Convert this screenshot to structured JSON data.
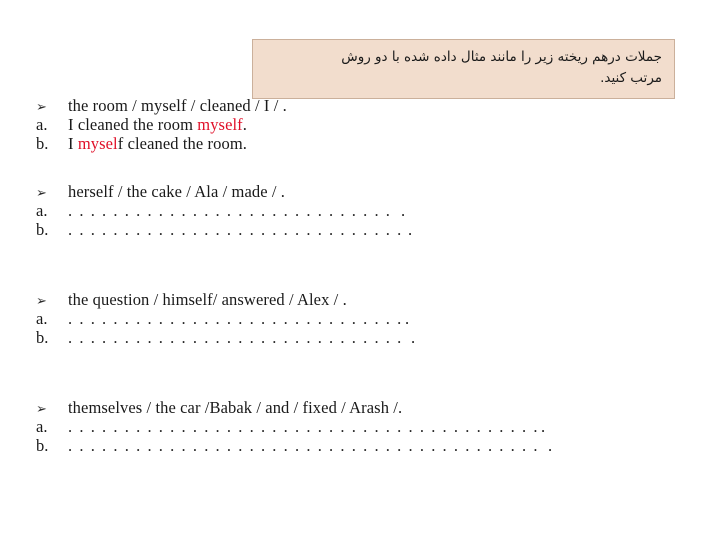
{
  "instruction": {
    "line1": "جملات درهم ریخته زیر را مانند مثال داده شده با دو روش",
    "line2": "مرتب کنید."
  },
  "markers": {
    "bullet": "➢",
    "a": "a.",
    "b": "b."
  },
  "colors": {
    "callout_bg": "#f2ddcd",
    "callout_border": "#cbb09b",
    "highlight_red": "#e01029",
    "text": "#1a1a1a",
    "page_bg": "#ffffff"
  },
  "dot_leader": ". . . . . . . . . . . . . . . . . . . . . . . . . . . . . . . . . . . . . . . . . . . . . . . . . . . . . . . . . . . . . . . . . . . . . . . . . . . . . . . . . . . . . . . . . .",
  "dot_tail": ".",
  "exercises": [
    {
      "prompt": "the room / myself / cleaned / I / .",
      "answer_a": {
        "filled": true,
        "parts": [
          {
            "text": "I cleaned the room ",
            "red": false
          },
          {
            "text": "myself",
            "red": true
          },
          {
            "text": ".",
            "red": false
          }
        ]
      },
      "answer_b": {
        "filled": true,
        "parts": [
          {
            "text": "I ",
            "red": false
          },
          {
            "text": "mysel",
            "red": true
          },
          {
            "text": "f cleaned the room.",
            "red": false
          }
        ]
      }
    },
    {
      "prompt": "herself  / the cake / Ala / made / .",
      "answer_a": {
        "filled": false
      },
      "answer_b": {
        "filled": false
      }
    },
    {
      "prompt": "the question / himself/ answered / Alex / .",
      "answer_a": {
        "filled": false
      },
      "answer_b": {
        "filled": false
      }
    },
    {
      "prompt": "themselves / the car /Babak / and /  fixed / Arash /.",
      "answer_a": {
        "filled": false
      },
      "answer_b": {
        "filled": false
      }
    }
  ]
}
